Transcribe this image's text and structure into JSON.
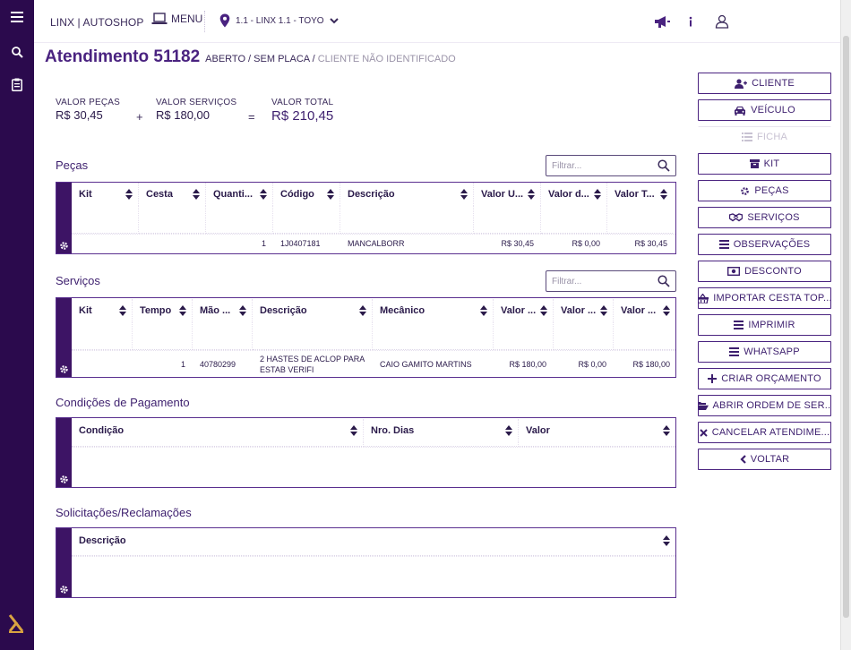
{
  "app": {
    "brand": "LINX | AUTOSHOP",
    "menu_label": "MENU",
    "store": "1.1 - LINX 1.1 - TOYO"
  },
  "page": {
    "title": "Atendimento 51182",
    "status_main": "ABERTO / SEM PLACA /",
    "status_muted": "CLIENTE NÃO IDENTIFICADO"
  },
  "totals": {
    "pecas_label": "VALOR PEÇAS",
    "pecas_value": "R$ 30,45",
    "plus": "+",
    "servicos_label": "VALOR SERVIÇOS",
    "servicos_value": "R$ 180,00",
    "equals": "=",
    "total_label": "VALOR TOTAL",
    "total_value": "R$ 210,45"
  },
  "filter_placeholder": "Filtrar...",
  "pecas": {
    "title": "Peças",
    "columns": [
      "Kit",
      "Cesta",
      "Quanti...",
      "Código",
      "Descrição",
      "Valor U...",
      "Valor d...",
      "Valor T..."
    ],
    "row": {
      "quantidade": "1",
      "codigo": "1J0407181",
      "descricao": "MANCALBORR",
      "valor_unit": "R$ 30,45",
      "valor_desc": "R$ 0,00",
      "valor_total": "R$ 30,45"
    }
  },
  "servicos": {
    "title": "Serviços",
    "columns": [
      "Kit",
      "Tempo",
      "Mão ...",
      "Descrição",
      "Mecânico",
      "Valor ...",
      "Valor ...",
      "Valor ..."
    ],
    "row": {
      "tempo": "1",
      "mao": "40780299",
      "descricao": "2 HASTES DE ACLOP PARA ESTAB VERIFI",
      "mecanico": "CAIO GAMITO MARTINS",
      "valor1": "R$ 180,00",
      "valor2": "R$ 0,00",
      "valor3": "R$ 180,00"
    }
  },
  "pagamento": {
    "title": "Condições de Pagamento",
    "columns": [
      "Condição",
      "Nro. Dias",
      "Valor"
    ]
  },
  "solicitacoes": {
    "title": "Solicitações/Reclamações",
    "columns": [
      "Descrição"
    ]
  },
  "actions": [
    {
      "label": "CLIENTE",
      "icon": "user-plus-icon"
    },
    {
      "label": "VEÍCULO",
      "icon": "car-icon"
    },
    {
      "label": "FICHA",
      "icon": "list-icon",
      "disabled": true
    },
    {
      "label": "KIT",
      "icon": "box-icon"
    },
    {
      "label": "PEÇAS",
      "icon": "gear-icon"
    },
    {
      "label": "SERVIÇOS",
      "icon": "handshake-icon"
    },
    {
      "label": "OBSERVAÇÕES",
      "icon": "menu-icon"
    },
    {
      "label": "DESCONTO",
      "icon": "money-icon"
    },
    {
      "label": "IMPORTAR CESTA TOP...",
      "icon": "basket-icon"
    },
    {
      "label": "IMPRIMIR",
      "icon": "menu-icon"
    },
    {
      "label": "WHATSAPP",
      "icon": "menu-icon"
    },
    {
      "label": "CRIAR ORÇAMENTO",
      "icon": "plus-icon"
    },
    {
      "label": "ABRIR ORDEM DE SER...",
      "icon": "folder-open-icon"
    },
    {
      "label": "CANCELAR ATENDIME...",
      "icon": "close-icon"
    },
    {
      "label": "VOLTAR",
      "icon": "chevron-left-icon"
    }
  ],
  "colors": {
    "sidebar": "#2b0a4d",
    "accent": "#4a2380",
    "grid_strip": "#3d1465"
  }
}
